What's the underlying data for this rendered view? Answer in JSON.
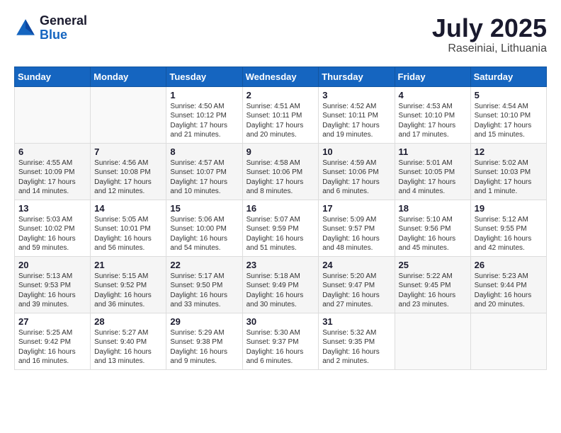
{
  "logo": {
    "general": "General",
    "blue": "Blue"
  },
  "title": {
    "month_year": "July 2025",
    "location": "Raseiniai, Lithuania"
  },
  "weekdays": [
    "Sunday",
    "Monday",
    "Tuesday",
    "Wednesday",
    "Thursday",
    "Friday",
    "Saturday"
  ],
  "weeks": [
    [
      {
        "day": "",
        "text": ""
      },
      {
        "day": "",
        "text": ""
      },
      {
        "day": "1",
        "text": "Sunrise: 4:50 AM\nSunset: 10:12 PM\nDaylight: 17 hours\nand 21 minutes."
      },
      {
        "day": "2",
        "text": "Sunrise: 4:51 AM\nSunset: 10:11 PM\nDaylight: 17 hours\nand 20 minutes."
      },
      {
        "day": "3",
        "text": "Sunrise: 4:52 AM\nSunset: 10:11 PM\nDaylight: 17 hours\nand 19 minutes."
      },
      {
        "day": "4",
        "text": "Sunrise: 4:53 AM\nSunset: 10:10 PM\nDaylight: 17 hours\nand 17 minutes."
      },
      {
        "day": "5",
        "text": "Sunrise: 4:54 AM\nSunset: 10:10 PM\nDaylight: 17 hours\nand 15 minutes."
      }
    ],
    [
      {
        "day": "6",
        "text": "Sunrise: 4:55 AM\nSunset: 10:09 PM\nDaylight: 17 hours\nand 14 minutes."
      },
      {
        "day": "7",
        "text": "Sunrise: 4:56 AM\nSunset: 10:08 PM\nDaylight: 17 hours\nand 12 minutes."
      },
      {
        "day": "8",
        "text": "Sunrise: 4:57 AM\nSunset: 10:07 PM\nDaylight: 17 hours\nand 10 minutes."
      },
      {
        "day": "9",
        "text": "Sunrise: 4:58 AM\nSunset: 10:06 PM\nDaylight: 17 hours\nand 8 minutes."
      },
      {
        "day": "10",
        "text": "Sunrise: 4:59 AM\nSunset: 10:06 PM\nDaylight: 17 hours\nand 6 minutes."
      },
      {
        "day": "11",
        "text": "Sunrise: 5:01 AM\nSunset: 10:05 PM\nDaylight: 17 hours\nand 4 minutes."
      },
      {
        "day": "12",
        "text": "Sunrise: 5:02 AM\nSunset: 10:03 PM\nDaylight: 17 hours\nand 1 minute."
      }
    ],
    [
      {
        "day": "13",
        "text": "Sunrise: 5:03 AM\nSunset: 10:02 PM\nDaylight: 16 hours\nand 59 minutes."
      },
      {
        "day": "14",
        "text": "Sunrise: 5:05 AM\nSunset: 10:01 PM\nDaylight: 16 hours\nand 56 minutes."
      },
      {
        "day": "15",
        "text": "Sunrise: 5:06 AM\nSunset: 10:00 PM\nDaylight: 16 hours\nand 54 minutes."
      },
      {
        "day": "16",
        "text": "Sunrise: 5:07 AM\nSunset: 9:59 PM\nDaylight: 16 hours\nand 51 minutes."
      },
      {
        "day": "17",
        "text": "Sunrise: 5:09 AM\nSunset: 9:57 PM\nDaylight: 16 hours\nand 48 minutes."
      },
      {
        "day": "18",
        "text": "Sunrise: 5:10 AM\nSunset: 9:56 PM\nDaylight: 16 hours\nand 45 minutes."
      },
      {
        "day": "19",
        "text": "Sunrise: 5:12 AM\nSunset: 9:55 PM\nDaylight: 16 hours\nand 42 minutes."
      }
    ],
    [
      {
        "day": "20",
        "text": "Sunrise: 5:13 AM\nSunset: 9:53 PM\nDaylight: 16 hours\nand 39 minutes."
      },
      {
        "day": "21",
        "text": "Sunrise: 5:15 AM\nSunset: 9:52 PM\nDaylight: 16 hours\nand 36 minutes."
      },
      {
        "day": "22",
        "text": "Sunrise: 5:17 AM\nSunset: 9:50 PM\nDaylight: 16 hours\nand 33 minutes."
      },
      {
        "day": "23",
        "text": "Sunrise: 5:18 AM\nSunset: 9:49 PM\nDaylight: 16 hours\nand 30 minutes."
      },
      {
        "day": "24",
        "text": "Sunrise: 5:20 AM\nSunset: 9:47 PM\nDaylight: 16 hours\nand 27 minutes."
      },
      {
        "day": "25",
        "text": "Sunrise: 5:22 AM\nSunset: 9:45 PM\nDaylight: 16 hours\nand 23 minutes."
      },
      {
        "day": "26",
        "text": "Sunrise: 5:23 AM\nSunset: 9:44 PM\nDaylight: 16 hours\nand 20 minutes."
      }
    ],
    [
      {
        "day": "27",
        "text": "Sunrise: 5:25 AM\nSunset: 9:42 PM\nDaylight: 16 hours\nand 16 minutes."
      },
      {
        "day": "28",
        "text": "Sunrise: 5:27 AM\nSunset: 9:40 PM\nDaylight: 16 hours\nand 13 minutes."
      },
      {
        "day": "29",
        "text": "Sunrise: 5:29 AM\nSunset: 9:38 PM\nDaylight: 16 hours\nand 9 minutes."
      },
      {
        "day": "30",
        "text": "Sunrise: 5:30 AM\nSunset: 9:37 PM\nDaylight: 16 hours\nand 6 minutes."
      },
      {
        "day": "31",
        "text": "Sunrise: 5:32 AM\nSunset: 9:35 PM\nDaylight: 16 hours\nand 2 minutes."
      },
      {
        "day": "",
        "text": ""
      },
      {
        "day": "",
        "text": ""
      }
    ]
  ]
}
